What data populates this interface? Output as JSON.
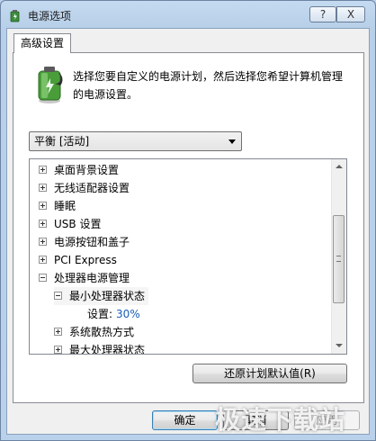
{
  "window": {
    "title": "电源选项",
    "help_label": "?",
    "close_label": "X"
  },
  "tabs": [
    {
      "label": "高级设置",
      "selected": true
    }
  ],
  "description": "选择您要自定义的电源计划，然后选择您希望计算机管理的电源设置。",
  "plan_select": {
    "value": "平衡 [活动]"
  },
  "settings_tree": {
    "items": [
      {
        "label": "桌面背景设置",
        "expander": "+",
        "level": 0
      },
      {
        "label": "无线适配器设置",
        "expander": "+",
        "level": 0
      },
      {
        "label": "睡眠",
        "expander": "+",
        "level": 0
      },
      {
        "label": "USB 设置",
        "expander": "+",
        "level": 0
      },
      {
        "label": "电源按钮和盖子",
        "expander": "+",
        "level": 0
      },
      {
        "label": "PCI Express",
        "expander": "+",
        "level": 0
      },
      {
        "label": "处理器电源管理",
        "expander": "-",
        "level": 0
      },
      {
        "label": "最小处理器状态",
        "expander": "-",
        "level": 1
      },
      {
        "label": "设置:",
        "value": "30%",
        "level": 2
      },
      {
        "label": "系统散热方式",
        "expander": "+",
        "level": 1
      },
      {
        "label": "最大处理器状态",
        "expander": "+",
        "level": 1
      }
    ]
  },
  "buttons": {
    "restore_defaults": "还原计划默认值(R)",
    "ok": "确定",
    "cancel": "取消",
    "apply": "应用"
  },
  "watermark": "极速下载站",
  "colors": {
    "accent": "#1a5fb4",
    "window_frame": "#b9d1ea",
    "disabled_text": "#8d8d8d"
  }
}
